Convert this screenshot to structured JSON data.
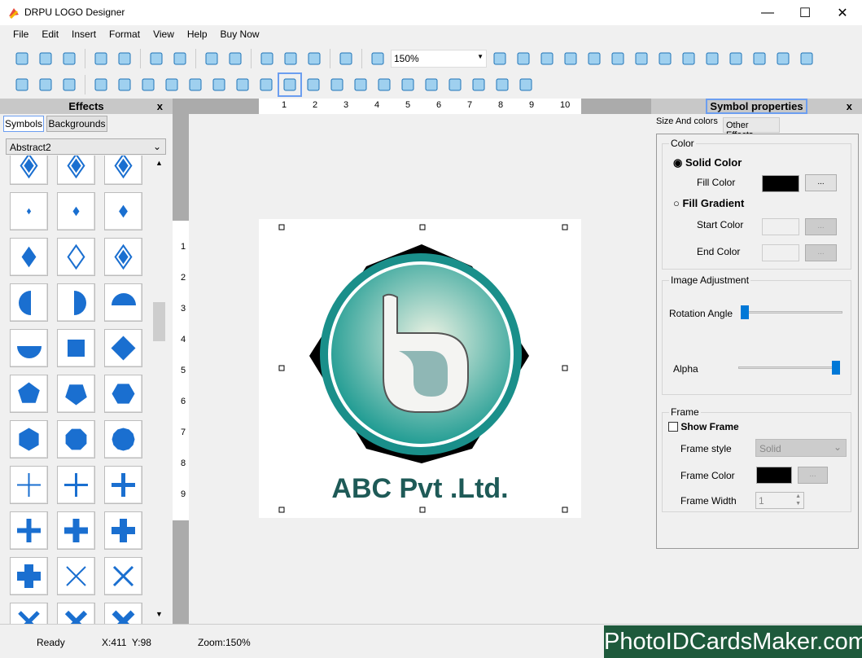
{
  "window": {
    "title": "DRPU LOGO Designer",
    "minimize": "—",
    "maximize": "☐",
    "close": "✕"
  },
  "menu": [
    "File",
    "Edit",
    "Insert",
    "Format",
    "View",
    "Help",
    "Buy Now"
  ],
  "toolbar1": {
    "icons": [
      "new-icon",
      "open-icon",
      "close-file-icon",
      "save-icon",
      "save-as-icon",
      "export-icon",
      "print-icon",
      "undo-icon",
      "redo-icon",
      "cut-icon",
      "copy-icon",
      "paste-icon",
      "delete-icon",
      "zoom-in-icon"
    ],
    "zoom_value": "150%",
    "icons_after": [
      "zoom-out-icon",
      "actual-size-icon",
      "fit-icon",
      "grid-icon",
      "edit-icon",
      "bring-front-icon",
      "send-back-icon",
      "align-left-icon",
      "align-right-icon",
      "align-center-icon",
      "align-top-icon",
      "align-bottom-icon",
      "lock-icon",
      "unlock-icon"
    ]
  },
  "toolbar2": {
    "icons": [
      "text-icon",
      "image-icon",
      "camera-icon",
      "layers-icon",
      "background-icon",
      "users-icon",
      "word-art-icon",
      "signature-icon",
      "watermark-icon",
      "line-icon",
      "rectangle-icon",
      "ellipse-icon",
      "rounded-rectangle-icon",
      "diamond-icon",
      "star-icon",
      "arc-icon",
      "cross-star-icon",
      "triangle-icon",
      "triangle-down-icon",
      "triangle-right-icon",
      "triangle-left-icon",
      "curve-icon"
    ],
    "selected": "ellipse-icon"
  },
  "effects": {
    "title": "Effects",
    "close": "x",
    "tabs": [
      "Symbols",
      "Backgrounds"
    ],
    "category": "Abstract2"
  },
  "ruler": {
    "h": [
      "1",
      "2",
      "3",
      "4",
      "5",
      "6",
      "7",
      "8",
      "9",
      "10"
    ],
    "v": [
      "1",
      "2",
      "3",
      "4",
      "5",
      "6",
      "7",
      "8",
      "9"
    ]
  },
  "logo": {
    "text": "ABC Pvt .Ltd.",
    "text_color": "#1e5a57",
    "ring_color": "#1a8f8a"
  },
  "symbol_props": {
    "title": "Symbol properties",
    "close": "x",
    "tabs": [
      "Size And colors",
      "Other Effects"
    ],
    "color": {
      "legend": "Color",
      "solid": "Solid Color",
      "fill_color": "Fill Color",
      "gradient": "Fill Gradient",
      "start": "Start Color",
      "end": "End Color",
      "button": "...",
      "fill_hex": "#000000",
      "selected": "solid"
    },
    "adjust": {
      "legend": "Image Adjustment",
      "rotation": "Rotation Angle",
      "alpha": "Alpha",
      "rotation_value": 0,
      "alpha_value": 100
    },
    "frame": {
      "legend": "Frame",
      "show": "Show Frame",
      "show_checked": false,
      "style_label": "Frame style",
      "style_value": "Solid",
      "color_label": "Frame Color",
      "width_label": "Frame Width",
      "width_value": "1",
      "button": "...",
      "color_hex": "#000000"
    }
  },
  "status": {
    "ready": "Ready",
    "coords": "X:411  Y:98",
    "zoom": "Zoom:150%"
  },
  "watermark": "PhotoIDCardsMaker.com"
}
